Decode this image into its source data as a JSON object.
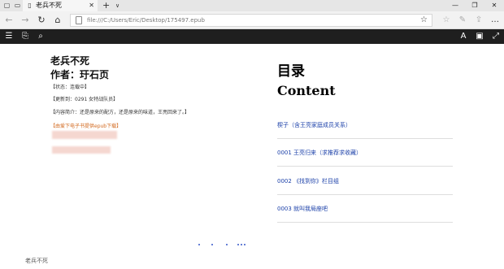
{
  "tab": {
    "title": "老兵不死"
  },
  "address_bar": {
    "url": "file:///C:/Users/Eric/Desktop/175497.epub"
  },
  "book": {
    "title": "老兵不死",
    "author": "作者：玗石页",
    "status": "【状态：连载中】",
    "latest": "【更新到：0291 女特战队员】",
    "intro": "【内容简介：还是原来的配方，还是原来的味道，王亮回来了。】",
    "download_link": "【由爱下电子书提供epub下载】"
  },
  "toc": {
    "heading": "目录",
    "subheading": "Content",
    "items": [
      {
        "label": "楔子（含王亮家庭成员关系）"
      },
      {
        "label": "0001 王亮归来（求推荐求收藏）"
      },
      {
        "label": "0002 《找到你》栏目组"
      },
      {
        "label": "0003 就叫我局座吧"
      }
    ]
  },
  "footer": {
    "title": "老兵不死"
  },
  "colors": {
    "link": "#1a3fa8",
    "download": "#d2691e",
    "reader_toolbar": "#1f1f1f"
  }
}
